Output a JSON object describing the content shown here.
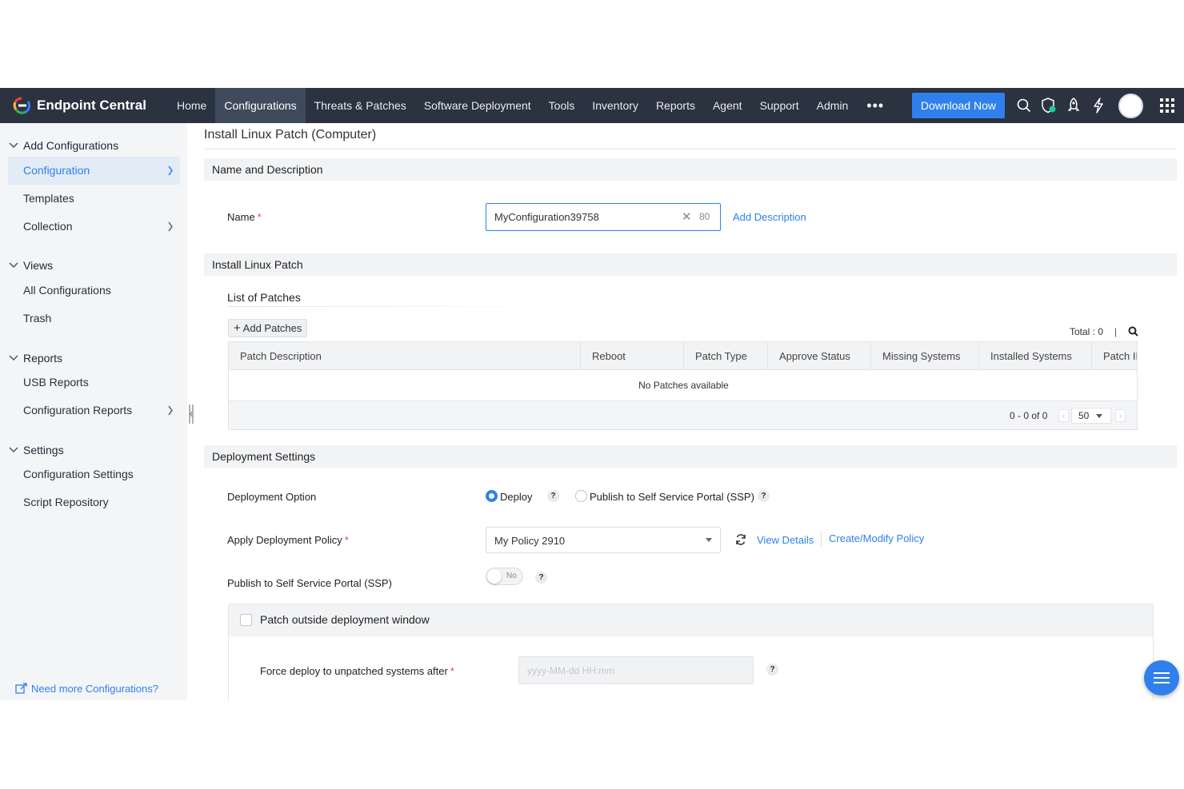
{
  "brand": {
    "name": "Endpoint Central"
  },
  "nav": {
    "items": [
      "Home",
      "Configurations",
      "Threats & Patches",
      "Software Deployment",
      "Tools",
      "Inventory",
      "Reports",
      "Agent",
      "Support",
      "Admin"
    ],
    "active": "Configurations",
    "more": "•••",
    "download_label": "Download Now"
  },
  "sidebar": {
    "sections": [
      {
        "title": "Add Configurations",
        "items": [
          "Configuration",
          "Templates",
          "Collection"
        ]
      },
      {
        "title": "Views",
        "items": [
          "All Configurations",
          "Trash"
        ]
      },
      {
        "title": "Reports",
        "items": [
          "USB Reports",
          "Configuration Reports"
        ]
      },
      {
        "title": "Settings",
        "items": [
          "Configuration Settings",
          "Script Repository"
        ]
      }
    ],
    "active_item": "Configuration",
    "footer_link": "Need more Configurations?"
  },
  "page": {
    "title": "Install Linux Patch (Computer)"
  },
  "name_section": {
    "title": "Name and Description",
    "name_label": "Name",
    "name_value": "MyConfiguration39758",
    "char_count": "80",
    "add_description": "Add Description"
  },
  "patch_section": {
    "title": "Install Linux Patch",
    "list_title": "List of Patches",
    "add_button": "Add Patches",
    "total": "Total : 0",
    "columns": [
      "Patch Description",
      "Reboot",
      "Patch Type",
      "Approve Status",
      "Missing Systems",
      "Installed Systems",
      "Patch ID"
    ],
    "empty_text": "No Patches available",
    "pager_range": "0 - 0 of 0",
    "page_size": "50"
  },
  "deployment": {
    "title": "Deployment Settings",
    "option_label": "Deployment Option",
    "deploy_label": "Deploy",
    "ssp_label": "Publish to Self Service Portal (SSP)",
    "selected_option": "Deploy",
    "policy_label": "Apply Deployment Policy",
    "policy_value": "My Policy 2910",
    "view_details": "View Details",
    "create_modify": "Create/Modify Policy",
    "publish_label": "Publish to Self Service Portal (SSP)",
    "toggle_text": "No",
    "outside_window_label": "Patch outside deployment window",
    "force_label": "Force deploy to unpatched systems after",
    "force_placeholder": "yyyy-MM-dd HH:mm",
    "help": "?"
  },
  "colors": {
    "accent": "#2f80ed",
    "nav_bg": "#2b3240",
    "required": "#e5484d"
  }
}
